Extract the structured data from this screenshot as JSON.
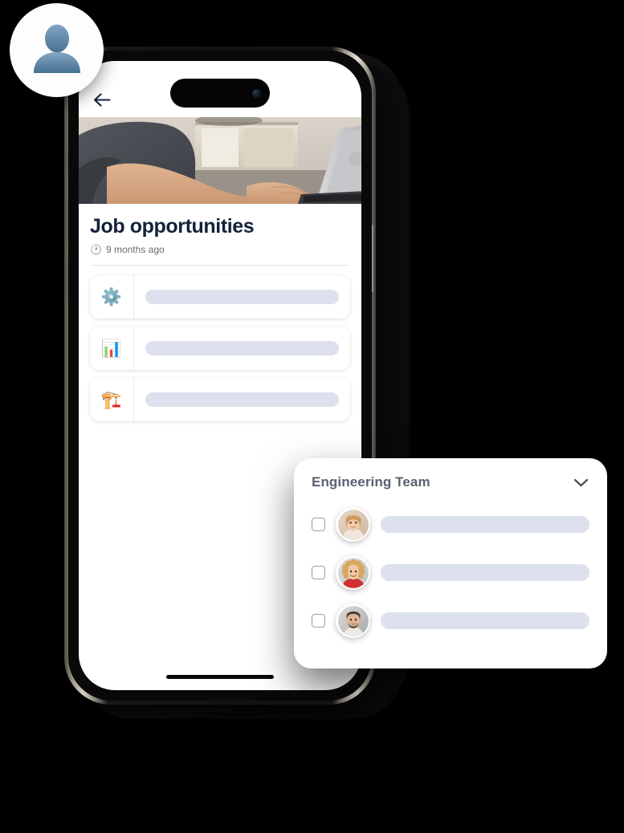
{
  "avatar_badge": {
    "icon": "user-silhouette-icon",
    "alt": "Default profile avatar"
  },
  "phone": {
    "dynamic_island": "dynamic-island",
    "home_indicator": "home-indicator",
    "buttons": [
      "ring-switch",
      "volume-up",
      "volume-down",
      "power"
    ]
  },
  "app": {
    "nav": {
      "back_icon": "back-arrow-icon"
    },
    "hero": {
      "alt": "Person in gray t-shirt typing on a laptop at a desk"
    },
    "title": "Job opportunities",
    "meta": {
      "icon": "clock-icon",
      "text": "9 months ago"
    },
    "cards": [
      {
        "icon": "⚙️",
        "icon_name": "gear-icon",
        "placeholder": ""
      },
      {
        "icon": "📊",
        "icon_name": "bar-chart-icon",
        "placeholder": ""
      },
      {
        "icon": "🏗️",
        "icon_name": "construction-crane-icon",
        "placeholder": ""
      }
    ]
  },
  "team_panel": {
    "title": "Engineering Team",
    "collapse_icon": "chevron-down-icon",
    "members": [
      {
        "avatar_alt": "Woman with long strawberry-blonde hair",
        "checked": false
      },
      {
        "avatar_alt": "Woman with curly blonde hair in red top",
        "checked": false
      },
      {
        "avatar_alt": "Man with short hair and beard",
        "checked": false
      }
    ]
  },
  "colors": {
    "skeleton": "#dde1ee",
    "title": "#14213b",
    "team_title": "#5b6172",
    "meta_text": "#6b6b70",
    "checkbox_border": "#9aa0ab"
  }
}
